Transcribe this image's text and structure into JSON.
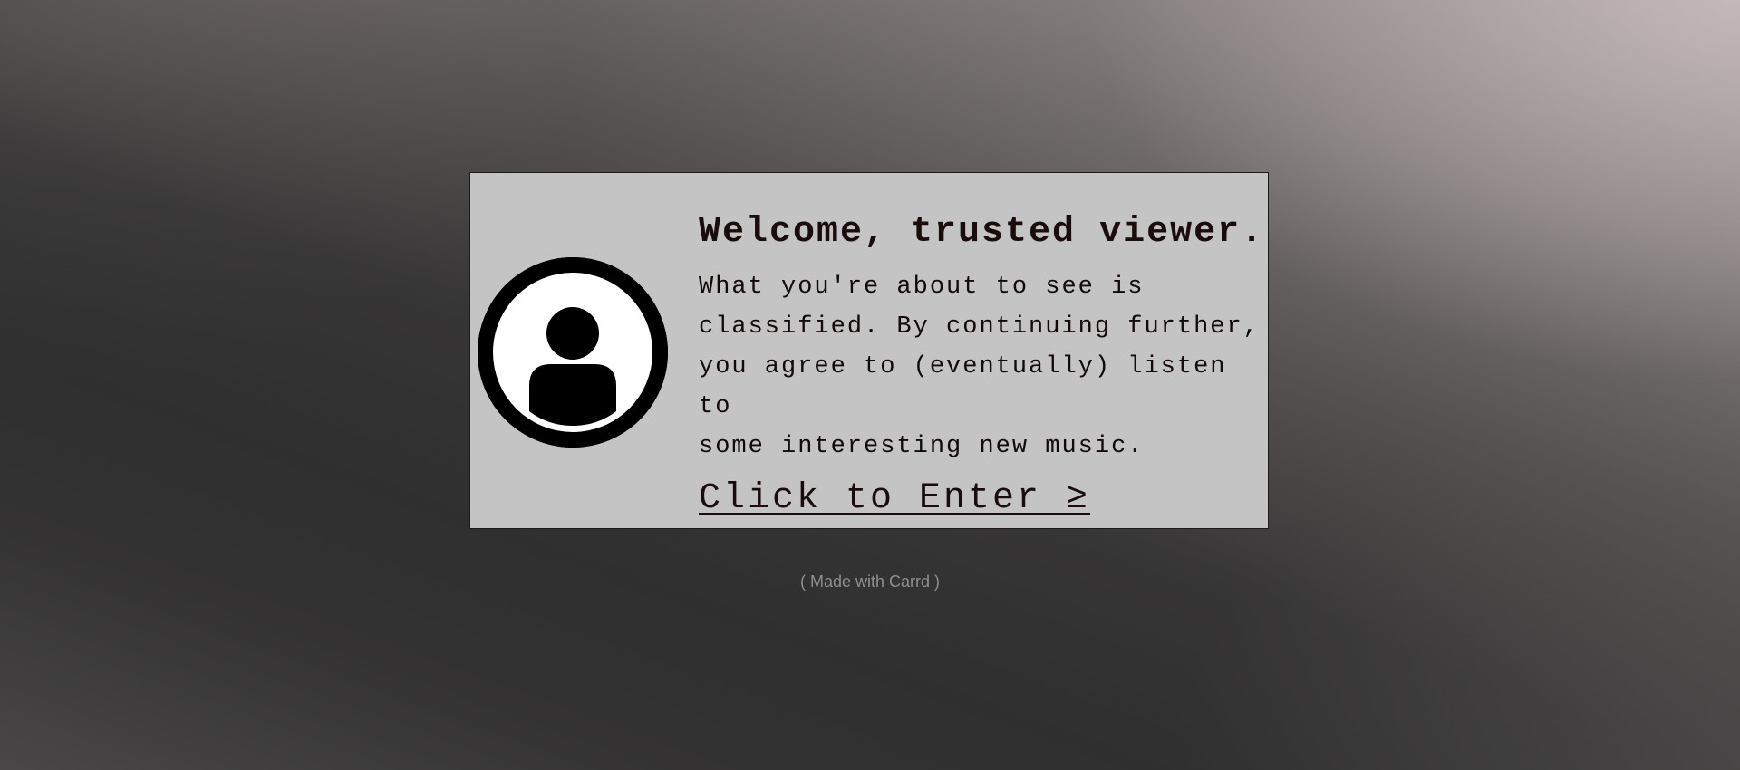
{
  "card": {
    "avatar_icon": "user-avatar-icon",
    "title": "Welcome, trusted viewer.",
    "body": "What you're about to see is\nclassified. By continuing further,\nyou agree to (eventually) listen to\nsome interesting new music.",
    "enter_label": "Click to Enter ≥"
  },
  "footer": {
    "made_with": "( Made with Carrd )"
  },
  "colors": {
    "card_background": "#c4c4c4",
    "text": "#1a0c0c",
    "footer_text": "#8f8f8f"
  }
}
